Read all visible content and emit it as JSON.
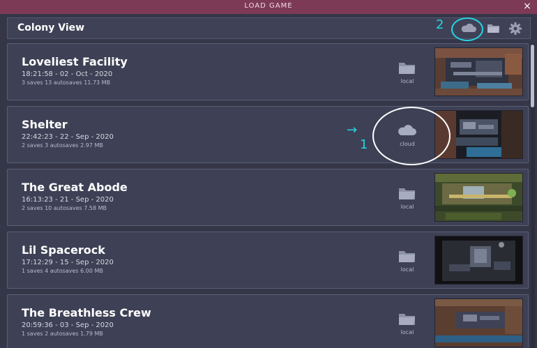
{
  "window": {
    "title": "LOAD GAME",
    "close_label": "×"
  },
  "header": {
    "title": "Colony View"
  },
  "annotations": {
    "label_cloud_toggle": "2",
    "label_cloud_item": "1",
    "arrow": "→",
    "color": "#27d4e4"
  },
  "colonies": [
    {
      "name": "Loveliest Facility",
      "datetime": "18:21:58 - 02 - Oct - 2020",
      "summary": "3 saves 13 autosaves 11.73 MB",
      "location": "local",
      "location_icon": "folder-icon"
    },
    {
      "name": "Shelter",
      "datetime": "22:42:23 - 22 - Sep - 2020",
      "summary": "2 saves 3 autosaves 2.97 MB",
      "location": "cloud",
      "location_icon": "cloud-icon"
    },
    {
      "name": "The Great Abode",
      "datetime": "16:13:23 - 21 - Sep - 2020",
      "summary": "2 saves 10 autosaves 7.58 MB",
      "location": "local",
      "location_icon": "folder-icon"
    },
    {
      "name": "Lil Spacerock",
      "datetime": "17:12:29 - 15 - Sep - 2020",
      "summary": "1 saves 4 autosaves 6.00 MB",
      "location": "local",
      "location_icon": "folder-icon"
    },
    {
      "name": "The Breathless Crew",
      "datetime": "20:59:36 - 03 - Sep - 2020",
      "summary": "1 saves 2 autosaves 1.79 MB",
      "location": "local",
      "location_icon": "folder-icon"
    }
  ],
  "colors": {
    "titlebar": "#7d3a57",
    "row_bg": "#3e4155",
    "panel_bg": "#353748",
    "icon": "#9a9fb3"
  }
}
